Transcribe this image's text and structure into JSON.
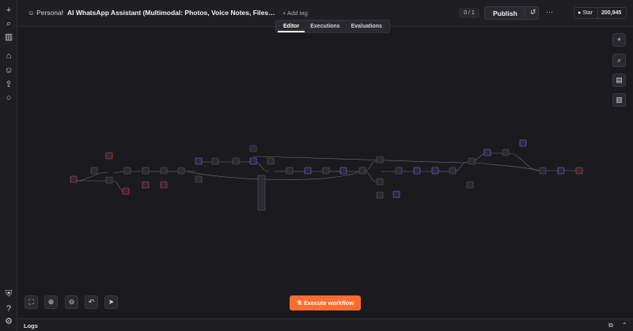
{
  "header": {
    "project": "Personal",
    "separator": "/",
    "workflow_title": "AI WhatsApp Assistant (Multimodal: Photos, Voice Notes, Files + Media R...",
    "add_tag": "+ Add tag",
    "counter": "0 / 1",
    "publish_label": "Publish",
    "github_star": "Star",
    "github_count": "200,945"
  },
  "tabs": [
    {
      "label": "Editor",
      "active": true
    },
    {
      "label": "Executions",
      "active": false
    },
    {
      "label": "Evaluations",
      "active": false
    }
  ],
  "execute_button": "Execute workflow",
  "logs_label": "Logs",
  "colors": {
    "accent": "#ff6d2e",
    "canvas_bg": "#1b1a1f",
    "node_border": "#5a5a62",
    "node_fill": "#2b2a30"
  }
}
